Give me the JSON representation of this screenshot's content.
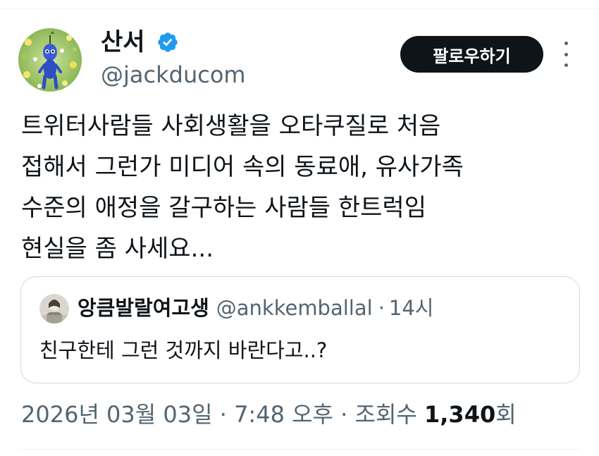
{
  "author": {
    "display_name": "산서",
    "handle": "@jackducom",
    "verified": true
  },
  "follow_button": {
    "label": "팔로우하기"
  },
  "more_icon": "more-vertical-icon",
  "tweet": {
    "text": "트위터사람들 사회생활을 오타쿠질로 처음\n접해서 그런가 미디어 속의 동료애, 유사가족\n수준의 애정을 갈구하는 사람들 한트럭임\n현실을 좀 사세요..."
  },
  "quoted_tweet": {
    "display_name": "앙큼발랄여고생",
    "handle": "@ankkemballal",
    "separator": "·",
    "time": "14시",
    "text": "친구한테 그런 것까지 바란다고..?"
  },
  "meta": {
    "date": "2026년 03월 03일",
    "separator": "·",
    "time": "7:48 오후",
    "views_label": "조회수",
    "views_count": "1,340",
    "views_suffix": "회"
  },
  "colors": {
    "text_primary": "#0f1419",
    "text_secondary": "#536471",
    "verified_blue": "#1d9bf0",
    "button_bg": "#0f1419",
    "border": "#cfd9de"
  }
}
